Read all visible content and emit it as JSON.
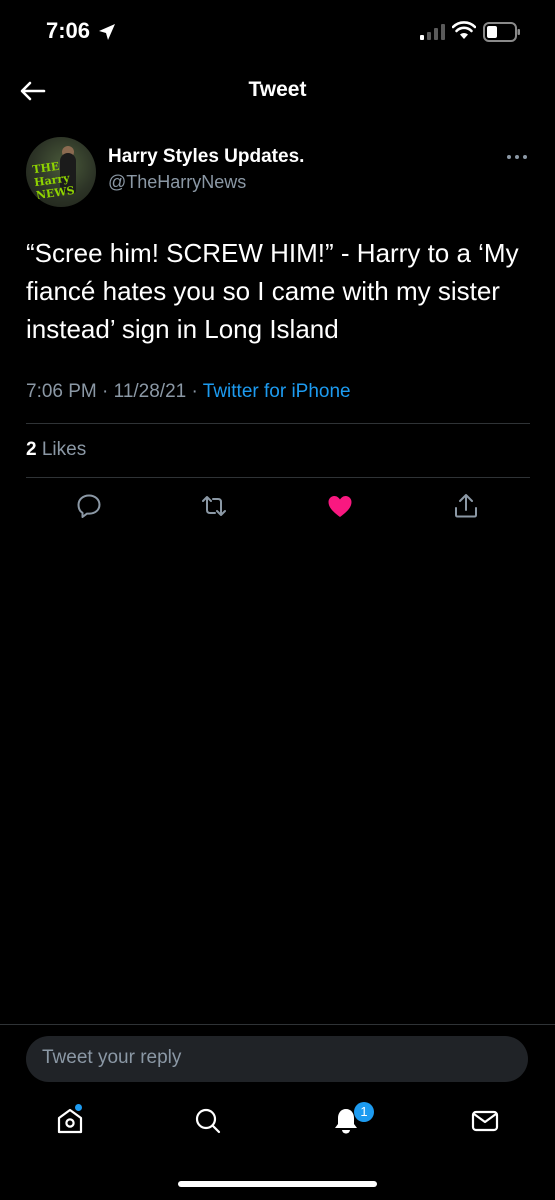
{
  "status_bar": {
    "time": "7:06"
  },
  "header": {
    "title": "Tweet"
  },
  "tweet": {
    "author_name": "Harry Styles Updates.",
    "author_handle": "@TheHarryNews",
    "avatar_text": "THE Harry NEWS",
    "text": "“Scree him! SCREW HIM!” - Harry to a ‘My fiancé hates you so I came with my sister instead’ sign in Long Island",
    "time": "7:06 PM",
    "date": "11/28/21",
    "source": "Twitter for iPhone",
    "separator": " · ",
    "likes_count": "2",
    "likes_label": "Likes",
    "liked": true
  },
  "actions": [
    "reply-icon",
    "retweet-icon",
    "like-icon",
    "share-icon"
  ],
  "reply": {
    "placeholder": "Tweet your reply"
  },
  "tabbar": {
    "items": [
      "home-icon",
      "search-icon",
      "notifications-icon",
      "messages-icon"
    ],
    "notification_badge": "1"
  },
  "colors": {
    "background": "#000000",
    "accent": "#1d9bf0",
    "like": "#f91880",
    "secondary_text": "#8b98a5"
  }
}
